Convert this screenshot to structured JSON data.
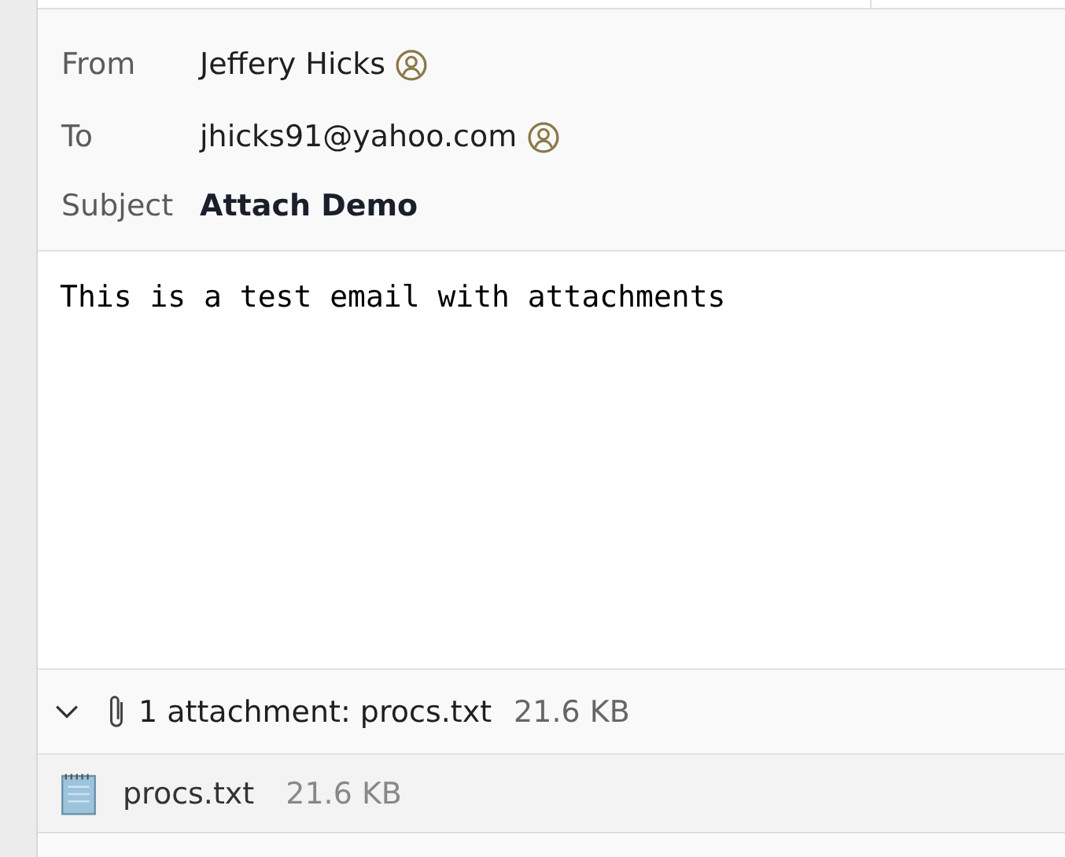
{
  "header": {
    "fields": [
      {
        "label": "From",
        "value": "Jeffery Hicks",
        "kind": "contact"
      },
      {
        "label": "To",
        "value": "jhicks91@yahoo.com",
        "kind": "contact"
      },
      {
        "label": "Subject",
        "value": "Attach Demo",
        "kind": "subject"
      }
    ]
  },
  "body": "This is a test email with attachments",
  "attachments": {
    "expanded": true,
    "summary": "1 attachment: procs.txt",
    "size": "21.6 KB",
    "files": [
      {
        "name": "procs.txt",
        "size": "21.6 KB"
      }
    ]
  }
}
